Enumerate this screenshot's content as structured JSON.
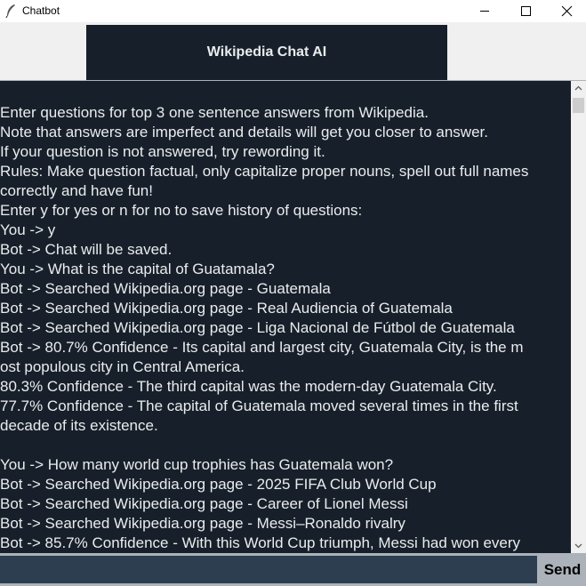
{
  "window": {
    "title": "Chatbot",
    "icon": "feather-icon"
  },
  "header": {
    "title": "Wikipedia Chat AI"
  },
  "chat": {
    "lines": [
      "Enter questions for top 3 one sentence answers from Wikipedia.",
      "Note that answers are imperfect and details will get you closer to answer.",
      "If your question is not answered, try rewording it.",
      "Rules: Make question factual, only capitalize proper nouns, spell out full names",
      "correctly and have fun!",
      "Enter y for yes or n for no to save history of questions:",
      "You -> y",
      "Bot -> Chat will be saved.",
      "You -> What is the capital of Guatamala?",
      "Bot -> Searched Wikipedia.org page - Guatemala",
      "Bot -> Searched Wikipedia.org page - Real Audiencia of Guatemala",
      "Bot -> Searched Wikipedia.org page - Liga Nacional de Fútbol de Guatemala",
      "Bot -> 80.7% Confidence - Its capital and largest city, Guatemala City, is the m",
      "ost populous city in Central America.",
      "80.3% Confidence - The third capital was the modern-day Guatemala City.",
      "77.7% Confidence - The capital of Guatemala moved several times in the first",
      "decade of its existence.",
      "",
      "You -> How many world cup trophies has Guatemala won?",
      "Bot -> Searched Wikipedia.org page - 2025 FIFA Club World Cup",
      "Bot -> Searched Wikipedia.org page - Career of Lionel Messi",
      "Bot -> Searched Wikipedia.org page - Messi–Ronaldo rivalry",
      "Bot -> 85.7% Confidence - With this World Cup triumph, Messi had won every"
    ]
  },
  "input": {
    "value": ""
  },
  "send": {
    "label": "Send"
  },
  "colors": {
    "background": "#17202a",
    "text": "#eaecee",
    "input_background": "#2c3e50",
    "button_background": "#abb2b9"
  }
}
